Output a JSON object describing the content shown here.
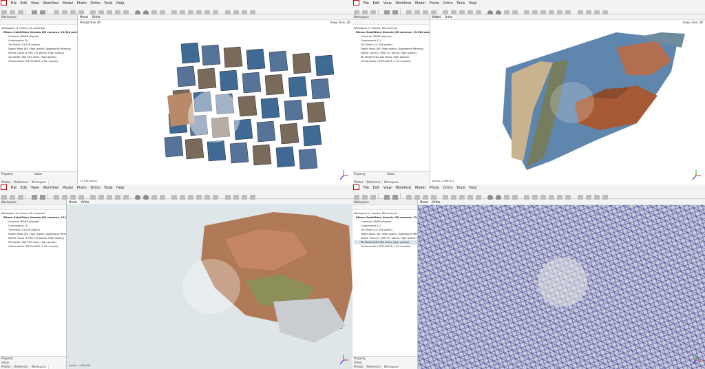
{
  "menu": {
    "file": "File",
    "edit": "Edit",
    "view": "View",
    "workflow": "Workflow",
    "model": "Model",
    "photo": "Photo",
    "ortho": "Ortho",
    "tools": "Tools",
    "help": "Help"
  },
  "workspace": {
    "header": "Workspace",
    "root": "Workspace (1 chunks, 85 cameras)",
    "chunk": "Ribeco SatelliHaro Venezia (85 cameras, 13,518 points)",
    "cameras": "Cameras (85/85 aligned)",
    "components": "Components (1)",
    "tie_points": "Tie Points (13,518 points)",
    "depth_maps": "Depth Maps (85, High quality, Aggressive filtering)",
    "dense_cloud": "Dense Cloud (1,956,711 points, High quality)",
    "model": "3D Model (581,261 faces, High quality)",
    "ortho": "Orthomosaic (3375x1876, 2.20 mm/pix)"
  },
  "property": {
    "property": "Property",
    "value": "Value",
    "tabs": [
      "Photos",
      "Reference",
      "Workspace"
    ]
  },
  "view_tabs": {
    "model": "Model",
    "ortho": "Ortho"
  },
  "views": {
    "q1": {
      "label": "Perspective 30°",
      "snap": "Snap: Axis, 3D",
      "status": "13,518 points"
    },
    "q2": {
      "label": "",
      "snap": "Snap: Axis, 3D",
      "status": "points: 1,496,311"
    },
    "q3": {
      "label": "Perspective 30°",
      "snap": "",
      "status": "points: 1,496,311"
    },
    "q4": {
      "label": "",
      "snap": "",
      "status": ""
    }
  },
  "colors": {
    "accent": "#0066cc",
    "water": "#4a78a6",
    "roof": "#b4552d",
    "mesh": "#5a5fa0"
  }
}
